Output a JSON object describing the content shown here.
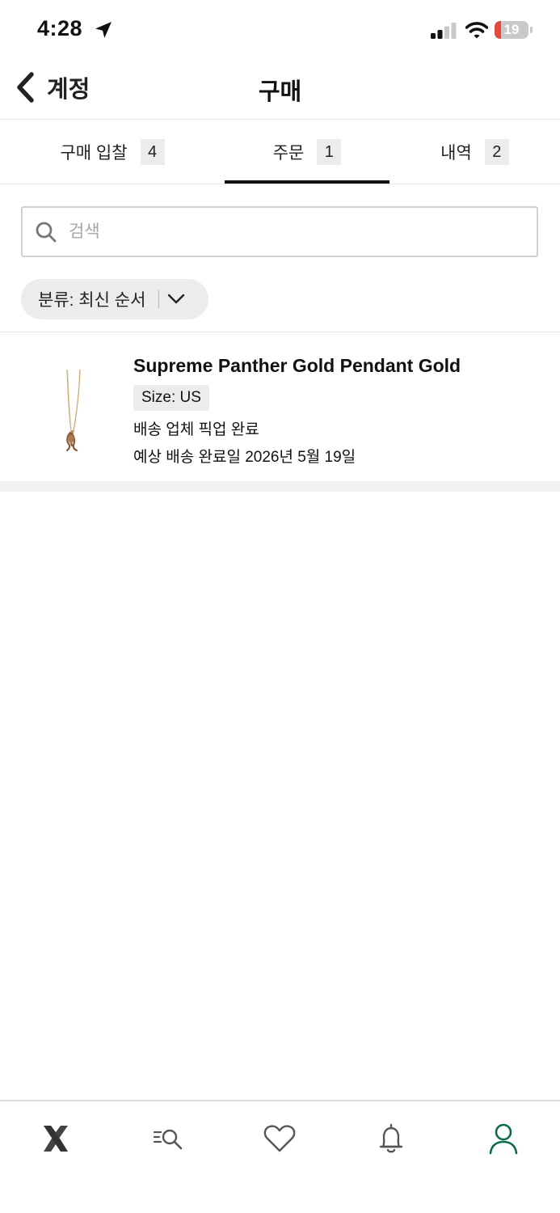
{
  "status_bar": {
    "time": "4:28",
    "battery_level": "19",
    "battery_fraction": 0.19,
    "icons": [
      "location-arrow-icon",
      "cellular-signal-icon",
      "wifi-icon",
      "battery-icon"
    ]
  },
  "header": {
    "back_label": "계정",
    "title": "구매"
  },
  "tabs": [
    {
      "label": "구매 입찰",
      "count": "4",
      "active": false
    },
    {
      "label": "주문",
      "count": "1",
      "active": true
    },
    {
      "label": "내역",
      "count": "2",
      "active": false
    }
  ],
  "search": {
    "placeholder": "검색",
    "value": ""
  },
  "sort": {
    "label": "분류: 최신 순서"
  },
  "orders": [
    {
      "name": "Supreme Panther Gold Pendant Gold",
      "size": "Size: US",
      "status": "배송 업체 픽업 완료",
      "delivery": "예상 배송 완료일 2026년 5월 19일"
    }
  ],
  "bottom_nav": {
    "items": [
      "home-x-icon",
      "search-list-icon",
      "heart-icon",
      "bell-icon",
      "profile-icon"
    ],
    "active_color": "#0a6b4c",
    "inactive_color": "#555555"
  }
}
